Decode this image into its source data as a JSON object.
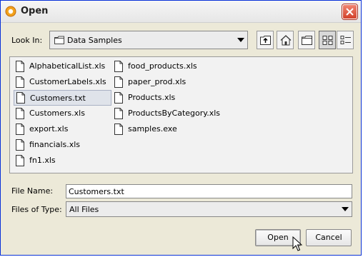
{
  "window": {
    "title": "Open"
  },
  "look_in": {
    "label": "Look In:",
    "value": "Data Samples"
  },
  "toolbar": {
    "icons": [
      "up-one-level-icon",
      "home-icon",
      "new-folder-icon",
      "list-view-icon",
      "details-view-icon"
    ]
  },
  "files": {
    "col1": [
      "AlphabeticalList.xls",
      "CustomerLabels.xls",
      "Customers.txt",
      "Customers.xls",
      "export.xls",
      "financials.xls",
      "fn1.xls"
    ],
    "col2": [
      "food_products.xls",
      "paper_prod.xls",
      "Products.xls",
      "ProductsByCategory.xls",
      "samples.exe"
    ],
    "selected": "Customers.txt"
  },
  "file_name": {
    "label": "File Name:",
    "value": "Customers.txt"
  },
  "file_type": {
    "label": "Files of Type:",
    "value": "All Files"
  },
  "buttons": {
    "open": "Open",
    "cancel": "Cancel"
  }
}
